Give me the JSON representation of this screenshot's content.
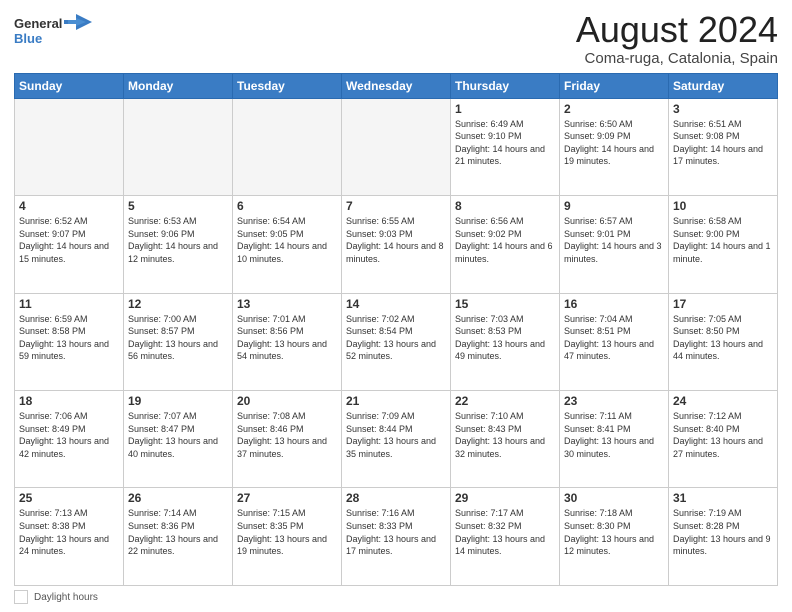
{
  "header": {
    "logo_general": "General",
    "logo_blue": "Blue",
    "month_title": "August 2024",
    "location": "Coma-ruga, Catalonia, Spain"
  },
  "footer": {
    "daylight_label": "Daylight hours"
  },
  "weekdays": [
    "Sunday",
    "Monday",
    "Tuesday",
    "Wednesday",
    "Thursday",
    "Friday",
    "Saturday"
  ],
  "weeks": [
    [
      {
        "day": "",
        "info": ""
      },
      {
        "day": "",
        "info": ""
      },
      {
        "day": "",
        "info": ""
      },
      {
        "day": "",
        "info": ""
      },
      {
        "day": "1",
        "info": "Sunrise: 6:49 AM\nSunset: 9:10 PM\nDaylight: 14 hours\nand 21 minutes."
      },
      {
        "day": "2",
        "info": "Sunrise: 6:50 AM\nSunset: 9:09 PM\nDaylight: 14 hours\nand 19 minutes."
      },
      {
        "day": "3",
        "info": "Sunrise: 6:51 AM\nSunset: 9:08 PM\nDaylight: 14 hours\nand 17 minutes."
      }
    ],
    [
      {
        "day": "4",
        "info": "Sunrise: 6:52 AM\nSunset: 9:07 PM\nDaylight: 14 hours\nand 15 minutes."
      },
      {
        "day": "5",
        "info": "Sunrise: 6:53 AM\nSunset: 9:06 PM\nDaylight: 14 hours\nand 12 minutes."
      },
      {
        "day": "6",
        "info": "Sunrise: 6:54 AM\nSunset: 9:05 PM\nDaylight: 14 hours\nand 10 minutes."
      },
      {
        "day": "7",
        "info": "Sunrise: 6:55 AM\nSunset: 9:03 PM\nDaylight: 14 hours\nand 8 minutes."
      },
      {
        "day": "8",
        "info": "Sunrise: 6:56 AM\nSunset: 9:02 PM\nDaylight: 14 hours\nand 6 minutes."
      },
      {
        "day": "9",
        "info": "Sunrise: 6:57 AM\nSunset: 9:01 PM\nDaylight: 14 hours\nand 3 minutes."
      },
      {
        "day": "10",
        "info": "Sunrise: 6:58 AM\nSunset: 9:00 PM\nDaylight: 14 hours\nand 1 minute."
      }
    ],
    [
      {
        "day": "11",
        "info": "Sunrise: 6:59 AM\nSunset: 8:58 PM\nDaylight: 13 hours\nand 59 minutes."
      },
      {
        "day": "12",
        "info": "Sunrise: 7:00 AM\nSunset: 8:57 PM\nDaylight: 13 hours\nand 56 minutes."
      },
      {
        "day": "13",
        "info": "Sunrise: 7:01 AM\nSunset: 8:56 PM\nDaylight: 13 hours\nand 54 minutes."
      },
      {
        "day": "14",
        "info": "Sunrise: 7:02 AM\nSunset: 8:54 PM\nDaylight: 13 hours\nand 52 minutes."
      },
      {
        "day": "15",
        "info": "Sunrise: 7:03 AM\nSunset: 8:53 PM\nDaylight: 13 hours\nand 49 minutes."
      },
      {
        "day": "16",
        "info": "Sunrise: 7:04 AM\nSunset: 8:51 PM\nDaylight: 13 hours\nand 47 minutes."
      },
      {
        "day": "17",
        "info": "Sunrise: 7:05 AM\nSunset: 8:50 PM\nDaylight: 13 hours\nand 44 minutes."
      }
    ],
    [
      {
        "day": "18",
        "info": "Sunrise: 7:06 AM\nSunset: 8:49 PM\nDaylight: 13 hours\nand 42 minutes."
      },
      {
        "day": "19",
        "info": "Sunrise: 7:07 AM\nSunset: 8:47 PM\nDaylight: 13 hours\nand 40 minutes."
      },
      {
        "day": "20",
        "info": "Sunrise: 7:08 AM\nSunset: 8:46 PM\nDaylight: 13 hours\nand 37 minutes."
      },
      {
        "day": "21",
        "info": "Sunrise: 7:09 AM\nSunset: 8:44 PM\nDaylight: 13 hours\nand 35 minutes."
      },
      {
        "day": "22",
        "info": "Sunrise: 7:10 AM\nSunset: 8:43 PM\nDaylight: 13 hours\nand 32 minutes."
      },
      {
        "day": "23",
        "info": "Sunrise: 7:11 AM\nSunset: 8:41 PM\nDaylight: 13 hours\nand 30 minutes."
      },
      {
        "day": "24",
        "info": "Sunrise: 7:12 AM\nSunset: 8:40 PM\nDaylight: 13 hours\nand 27 minutes."
      }
    ],
    [
      {
        "day": "25",
        "info": "Sunrise: 7:13 AM\nSunset: 8:38 PM\nDaylight: 13 hours\nand 24 minutes."
      },
      {
        "day": "26",
        "info": "Sunrise: 7:14 AM\nSunset: 8:36 PM\nDaylight: 13 hours\nand 22 minutes."
      },
      {
        "day": "27",
        "info": "Sunrise: 7:15 AM\nSunset: 8:35 PM\nDaylight: 13 hours\nand 19 minutes."
      },
      {
        "day": "28",
        "info": "Sunrise: 7:16 AM\nSunset: 8:33 PM\nDaylight: 13 hours\nand 17 minutes."
      },
      {
        "day": "29",
        "info": "Sunrise: 7:17 AM\nSunset: 8:32 PM\nDaylight: 13 hours\nand 14 minutes."
      },
      {
        "day": "30",
        "info": "Sunrise: 7:18 AM\nSunset: 8:30 PM\nDaylight: 13 hours\nand 12 minutes."
      },
      {
        "day": "31",
        "info": "Sunrise: 7:19 AM\nSunset: 8:28 PM\nDaylight: 13 hours\nand 9 minutes."
      }
    ]
  ]
}
